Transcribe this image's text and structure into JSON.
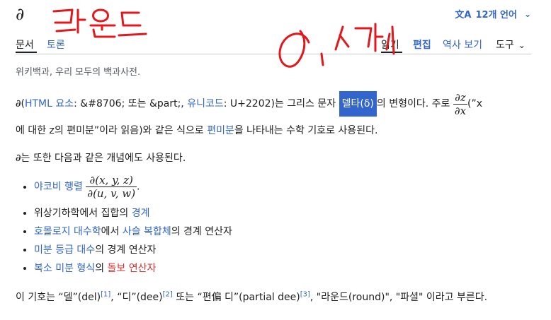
{
  "header": {
    "title": "∂",
    "lang_label": "12개 언어",
    "lang_icon": "文A"
  },
  "tabs": {
    "article": "문서",
    "talk": "토론",
    "read": "읽기",
    "edit": "편집",
    "history": "역사 보기",
    "tools": "도구"
  },
  "tagline": "위키백과, 우리 모두의 백과사전.",
  "para1": {
    "sym": "∂",
    "p_open": "(",
    "html_link": "HTML 요소",
    "t1": ": &#8706; 또는 &part;, ",
    "unicode_link": "유니코드",
    "t2": ": U+2202)는 그리스 문자 ",
    "delta_link": "델타(δ)",
    "t3": "의 변형이다. 주로 ",
    "frac_num": "∂z",
    "frac_den": "∂x",
    "t4": "(”x",
    "t5": "에 대한 z의 편미분”이라 읽음)와 같은 식으로 ",
    "partial_link": "편미분",
    "t6": "을 나타내는 수학 기호로 사용된다."
  },
  "para2": {
    "sym": "∂",
    "text": "는 또한 다음과 같은 개념에도 사용된다."
  },
  "list": {
    "li1_link": "야코비 행렬",
    "li1_num": "∂(x, y, z)",
    "li1_den": "∂(u, v, w)",
    "li1_dot": ".",
    "li2_text": "위상기하학에서 집합의 ",
    "li2_link": "경계",
    "li3_link1": "호몰로지 대수학",
    "li3_t1": "에서 ",
    "li3_link2": "사슬 복합체",
    "li3_t2": "의 경계 연산자",
    "li4_link": "미분 등급 대수",
    "li4_t": "의 경계 연산자",
    "li5_link": "복소 미분 형식",
    "li5_t": "의 ",
    "li5_redlink": "돌보 연산자"
  },
  "para3": {
    "t1": "이 기호는 “델”(del)",
    "ref1": "[1]",
    "t2": ", “디”(dee)",
    "ref2": "[2]",
    "t3": " 또는 “편偏 디”(partial dee)",
    "ref3": "[3]",
    "t4": ", \"라운드(round)\", \"파셜\" 이라고 부른다."
  },
  "colors": {
    "link": "#3366cc",
    "redlink": "#d73333",
    "annotation": "#e0191f",
    "selection": "#3366cc"
  }
}
